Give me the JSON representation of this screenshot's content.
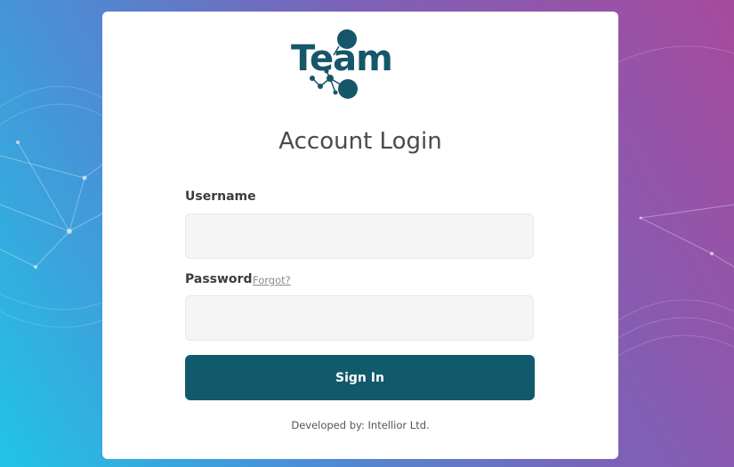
{
  "logo": {
    "text": "Team",
    "color": "#15566a"
  },
  "login": {
    "title": "Account Login",
    "username_label": "Username",
    "username_value": "",
    "password_label": "Password",
    "password_value": "",
    "forgot_link": "Forgot?",
    "signin_label": "Sign In"
  },
  "footer": {
    "text": "Developed by: Intellior Ltd."
  },
  "colors": {
    "primary": "#105a6b",
    "bg_gradient_start": "#21c4e6",
    "bg_gradient_end": "#a64a9e",
    "field_bg": "#f5f5f5"
  }
}
